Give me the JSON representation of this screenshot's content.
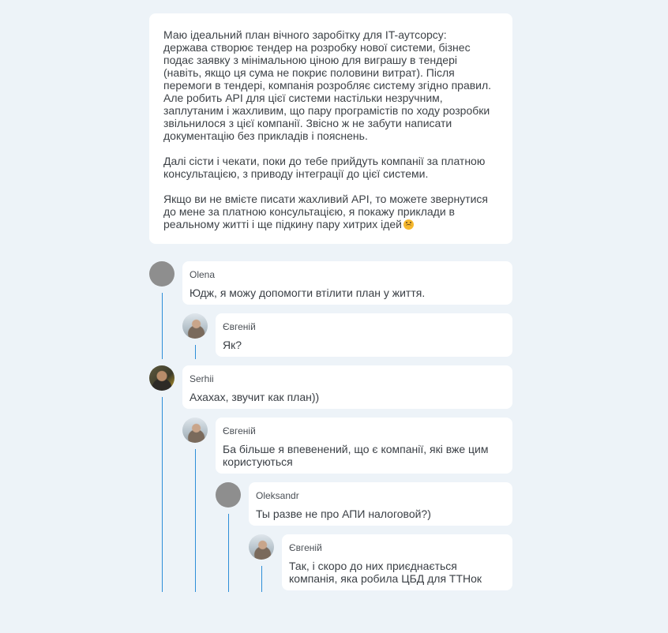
{
  "post": {
    "paragraphs": [
      "Маю ідеальний план вічного заробітку для IT-аутсорсу:\nдержава створює тендер на розробку нової системи, бізнес\nподає заявку з мінімальною ціною для виграшу в тендері\n(навіть, якщо ця сума не покриє половини витрат). Після\nперемоги в тендері, компанія розробляє систему згідно правил.\nАле робить API для цієї системи настільки незручним,\nзаплутаним і жахливим, що пару програмістів по ходу розробки\nзвільнилося з цієї компанії. Звісно ж не забути написати\nдокументацію без прикладів і пояснень.",
      "Далі сісти і чекати, поки до тебе прийдуть компанії за платною\nконсультацією, з приводу інтеграції до цієї системи.",
      "Якщо ви не вмієте писати жахливий API, то можете звернутися\nдо мене за платною консультацією, я покажу приклади в\nреальному житті і ще підкину пару хитрих ідей"
    ],
    "emoji": "upside-down-face-icon"
  },
  "comments": [
    {
      "author": "Olena",
      "text": "Юдж, я можу допомогти втілити план у життя.",
      "avatar": "gray"
    },
    {
      "author": "Євгеній",
      "text": "Як?",
      "avatar": "photo"
    },
    {
      "author": "Serhii",
      "text": "Ахахах, звучит как план))",
      "avatar": "photo"
    },
    {
      "author": "Євгеній",
      "text": "Ба більше я впевенений, що є компанії, які вже цим\nкористуються",
      "avatar": "photo"
    },
    {
      "author": "Oleksandr",
      "text": "Ты разве не про АПИ налоговой?)",
      "avatar": "gray"
    },
    {
      "author": "Євгеній",
      "text": "Так, і скоро до них приєднається\nкомпанія, яка робила ЦБД для ТТНок",
      "avatar": "photo"
    }
  ],
  "colors": {
    "background": "#edf3f8",
    "card": "#ffffff",
    "thread_line": "#2d8ed8",
    "avatar_placeholder": "#8e8e8e"
  }
}
